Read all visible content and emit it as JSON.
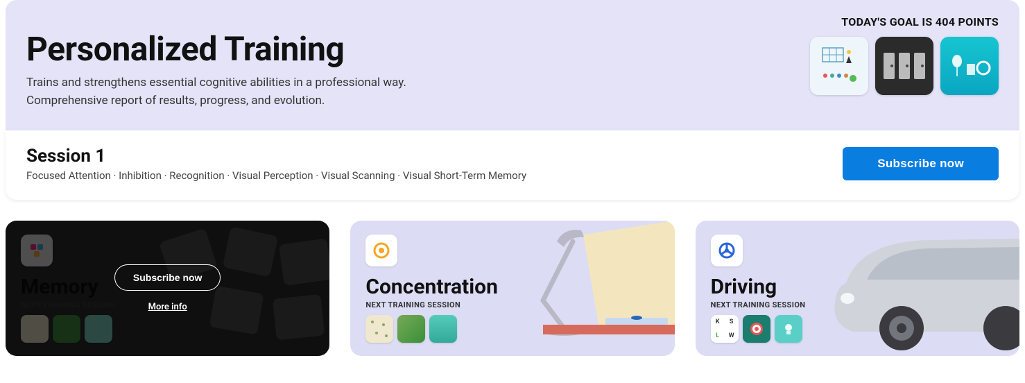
{
  "hero": {
    "title": "Personalized Training",
    "subtitle_line1": "Trains and strengthens essential cognitive abilities in a professional way.",
    "subtitle_line2": "Comprehensive report of results, progress, and evolution.",
    "goal_label": "TODAY'S GOAL IS 404 POINTS"
  },
  "session": {
    "title": "Session 1",
    "tags": "Focused Attention · Inhibition · Recognition · Visual Perception · Visual Scanning · Visual Short-Term Memory",
    "cta": "Subscribe now"
  },
  "cards": {
    "memory": {
      "title": "Memory",
      "next": "NEXT TRAINING SESSION",
      "overlay_cta": "Subscribe now",
      "overlay_link": "More info"
    },
    "concentration": {
      "title": "Concentration",
      "next": "NEXT TRAINING SESSION"
    },
    "driving": {
      "title": "Driving",
      "next": "NEXT TRAINING SESSION"
    }
  }
}
